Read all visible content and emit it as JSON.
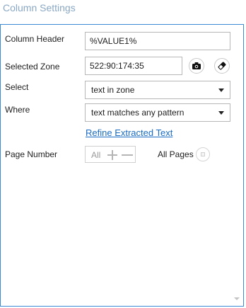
{
  "header": {
    "title": "Column Settings"
  },
  "fields": {
    "column_header": {
      "label": "Column Header",
      "value": "%VALUE1%"
    },
    "selected_zone": {
      "label": "Selected Zone",
      "value": "522:90:174:35"
    },
    "select": {
      "label": "Select",
      "value": "text in zone"
    },
    "where": {
      "label": "Where",
      "value": "text matches any pattern"
    },
    "refine_link": "Refine Extracted Text",
    "page_number": {
      "label": "Page Number",
      "value": "All"
    },
    "all_pages": {
      "label": "All Pages"
    }
  },
  "icons": {
    "capture": "camera-icon",
    "clear": "eraser-icon"
  },
  "colors": {
    "panel_border": "#3c8ad6",
    "title": "#8aa8c4",
    "link": "#1a6bc4"
  }
}
